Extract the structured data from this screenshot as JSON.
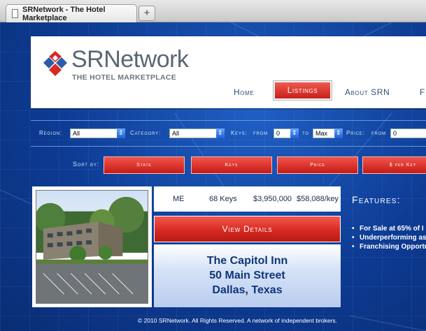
{
  "browser": {
    "tab_title": "SRNetwork - The Hotel Marketplace",
    "new_tab_label": "+"
  },
  "header": {
    "logo_name": "SRNetwork",
    "logo_tagline": "THE HOTEL MARKETPLACE",
    "nav": [
      {
        "label": "Home"
      },
      {
        "label": "Listings",
        "active": true
      },
      {
        "label": "About SRN"
      },
      {
        "label": "F"
      }
    ]
  },
  "filters": {
    "region_label": "Region:",
    "region_value": "All",
    "category_label": "Category:",
    "category_value": "All",
    "keys_label": "Keys:",
    "from_label": "from",
    "keys_from_value": "0",
    "to_label": "to",
    "keys_to_value": "Max",
    "price_label": "Price:",
    "price_from_label": "from",
    "price_from_value": "0"
  },
  "sort": {
    "label": "Sort by:",
    "buttons": [
      "State",
      "Keys",
      "Price",
      "$ per Key"
    ]
  },
  "listing": {
    "state": "ME",
    "keys": "68 Keys",
    "price": "$3,950,000",
    "per_key": "$58,088/key",
    "details_button": "View Details",
    "name": "The Capitol Inn",
    "street": "50 Main Street",
    "city": "Dallas, Texas",
    "features_title": "Features:",
    "features": [
      "For Sale at 65% of I",
      "Underperforming as",
      "Franchising Opportu"
    ]
  },
  "footer": {
    "text": "© 2010 SRNetwork. All Rights Reserved. A network of independent brokers."
  },
  "colors": {
    "site_blue": "#0d3b93",
    "accent_red": "#d62b23",
    "nav_text": "#2c4f7a"
  }
}
